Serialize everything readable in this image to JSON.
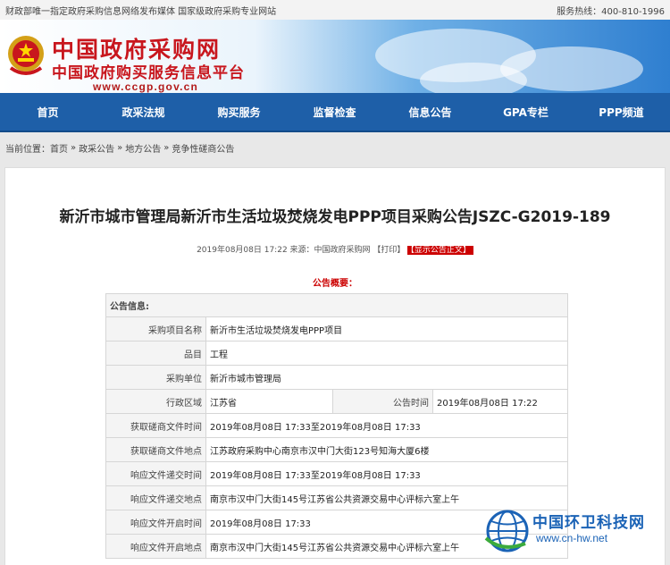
{
  "topbar": {
    "left": "财政部唯一指定政府采购信息网络发布媒体 国家级政府采购专业网站",
    "hotline": "服务热线：400-810-1996"
  },
  "banner": {
    "logo_cn": "中国政府采购网",
    "logo_sub": "中国政府购买服务信息平台",
    "url": "www.ccgp.gov.cn"
  },
  "nav": [
    "首页",
    "政采法规",
    "购买服务",
    "监督检查",
    "信息公告",
    "GPA专栏",
    "PPP频道"
  ],
  "breadcrumb": {
    "prefix": "当前位置：",
    "items": [
      "首页",
      "政采公告",
      "地方公告",
      "竞争性磋商公告"
    ],
    "sep": "»"
  },
  "article": {
    "title": "新沂市城市管理局新沂市生活垃圾焚烧发电PPP项目采购公告JSZC-G2019-189",
    "meta": "2019年08月08日 17:22 来源：中国政府采购网 【打印】",
    "show_body": "【显示公告正文】",
    "summary": "公告概要："
  },
  "table": {
    "header": "公告信息:",
    "rows": [
      {
        "label": "采购项目名称",
        "value": "新沂市生活垃圾焚烧发电PPP项目"
      },
      {
        "label": "品目",
        "value": "工程"
      },
      {
        "label": "采购单位",
        "value": "新沂市城市管理局"
      },
      {
        "label": "行政区域",
        "value": "江苏省",
        "label2": "公告时间",
        "value2": "2019年08月08日 17:22"
      },
      {
        "label": "获取磋商文件时间",
        "value": "2019年08月08日 17:33至2019年08月08日 17:33"
      },
      {
        "label": "获取磋商文件地点",
        "value": "江苏政府采购中心南京市汉中门大街123号知海大厦6楼"
      },
      {
        "label": "响应文件递交时间",
        "value": "2019年08月08日 17:33至2019年08月08日 17:33"
      },
      {
        "label": "响应文件递交地点",
        "value": "南京市汉中门大街145号江苏省公共资源交易中心评标六室上午"
      },
      {
        "label": "响应文件开启时间",
        "value": "2019年08月08日 17:33"
      },
      {
        "label": "响应文件开启地点",
        "value": "南京市汉中门大街145号江苏省公共资源交易中心评标六室上午"
      }
    ]
  },
  "watermark": {
    "text": "中国环卫科技网",
    "url": "www.cn-hw.net"
  },
  "colors": {
    "nav": "#1e5fa8",
    "brand_red": "#c8161d",
    "watermark_blue": "#1b63b6"
  }
}
